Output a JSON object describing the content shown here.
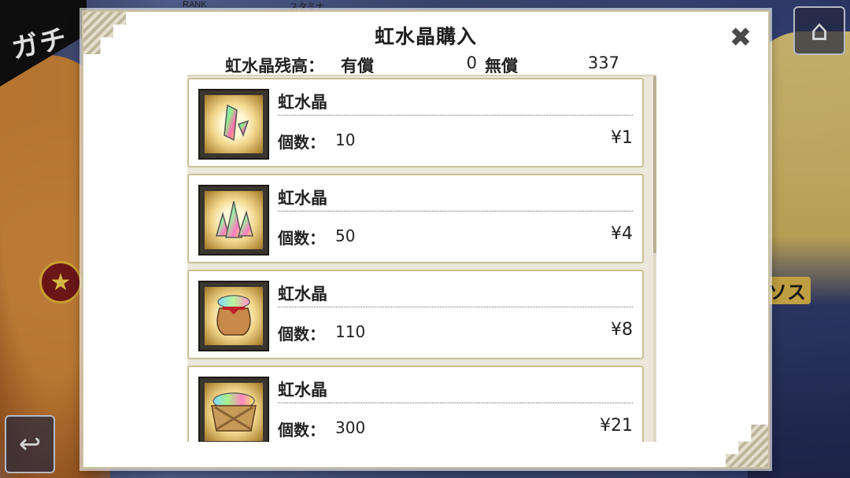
{
  "background": {
    "title_fragment": "ガチ",
    "rank_label": "RANK",
    "stamina_label": "スタミナ",
    "right_label_fragment": "ソス"
  },
  "modal": {
    "title": "虹水晶購入",
    "balance": {
      "label": "虹水晶残高：",
      "paid_label": "有償",
      "paid_value": "0",
      "free_label": "無償",
      "free_value": "337"
    },
    "items": [
      {
        "name": "虹水晶",
        "count_label": "個数：",
        "count": "10",
        "price": "¥1",
        "icon": "rainbow-crystal-shard-icon"
      },
      {
        "name": "虹水晶",
        "count_label": "個数：",
        "count": "50",
        "price": "¥4",
        "icon": "rainbow-crystal-cluster-icon"
      },
      {
        "name": "虹水晶",
        "count_label": "個数：",
        "count": "110",
        "price": "¥8",
        "icon": "crystal-bag-icon"
      },
      {
        "name": "虹水晶",
        "count_label": "個数：",
        "count": "300",
        "price": "¥21",
        "icon": "crystal-crate-icon"
      }
    ]
  },
  "colors": {
    "item_border": "#c9bf92",
    "modal_bg": "#ffffff",
    "list_bg": "#ebe7da"
  }
}
